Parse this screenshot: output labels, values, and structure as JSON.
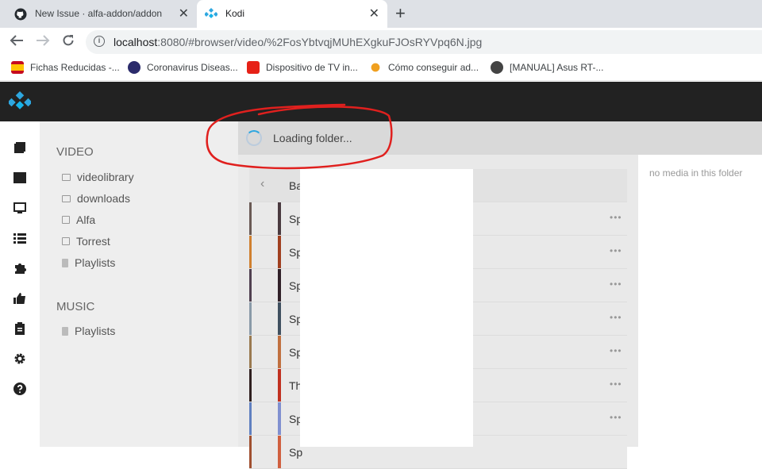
{
  "browser": {
    "tabs": [
      {
        "title": "New Issue · alfa-addon/addon",
        "icon": "github-icon"
      },
      {
        "title": "Kodi",
        "icon": "kodi-icon"
      }
    ],
    "close_glyph": "✕",
    "new_tab_glyph": "+",
    "url_host": "localhost",
    "url_rest": ":8080/#browser/video/%2FosYbtvqjMUhEXgkuFJOsRYVpq6N.jpg",
    "bookmarks": [
      {
        "label": "Fichas Reducidas -...",
        "color": "#c60b1e"
      },
      {
        "label": "Coronavirus Diseas...",
        "color": "#2b2b6b"
      },
      {
        "label": "Dispositivo de TV in...",
        "color": "#e62117"
      },
      {
        "label": "Cómo conseguir ad...",
        "color": "#f0a020"
      },
      {
        "label": "[MANUAL] Asus RT-...",
        "color": "#444444"
      }
    ]
  },
  "kodi": {
    "sections": [
      {
        "title": "VIDEO",
        "items": [
          "videolibrary",
          "downloads",
          "Alfa",
          "Torrest",
          "Playlists"
        ]
      },
      {
        "title": "MUSIC",
        "items": [
          "Playlists"
        ]
      }
    ],
    "loading_text": "Loading folder...",
    "no_media_text": "no media in this folder",
    "rows": [
      "Ba",
      "Sp",
      "Sp",
      "Sp",
      "Sp",
      "Sp",
      "Th",
      "Sp",
      "Sp"
    ],
    "dots": "•••",
    "back_glyph": "‹",
    "accent_color": "#2ea7e0",
    "annotation_color": "#e0201e"
  }
}
